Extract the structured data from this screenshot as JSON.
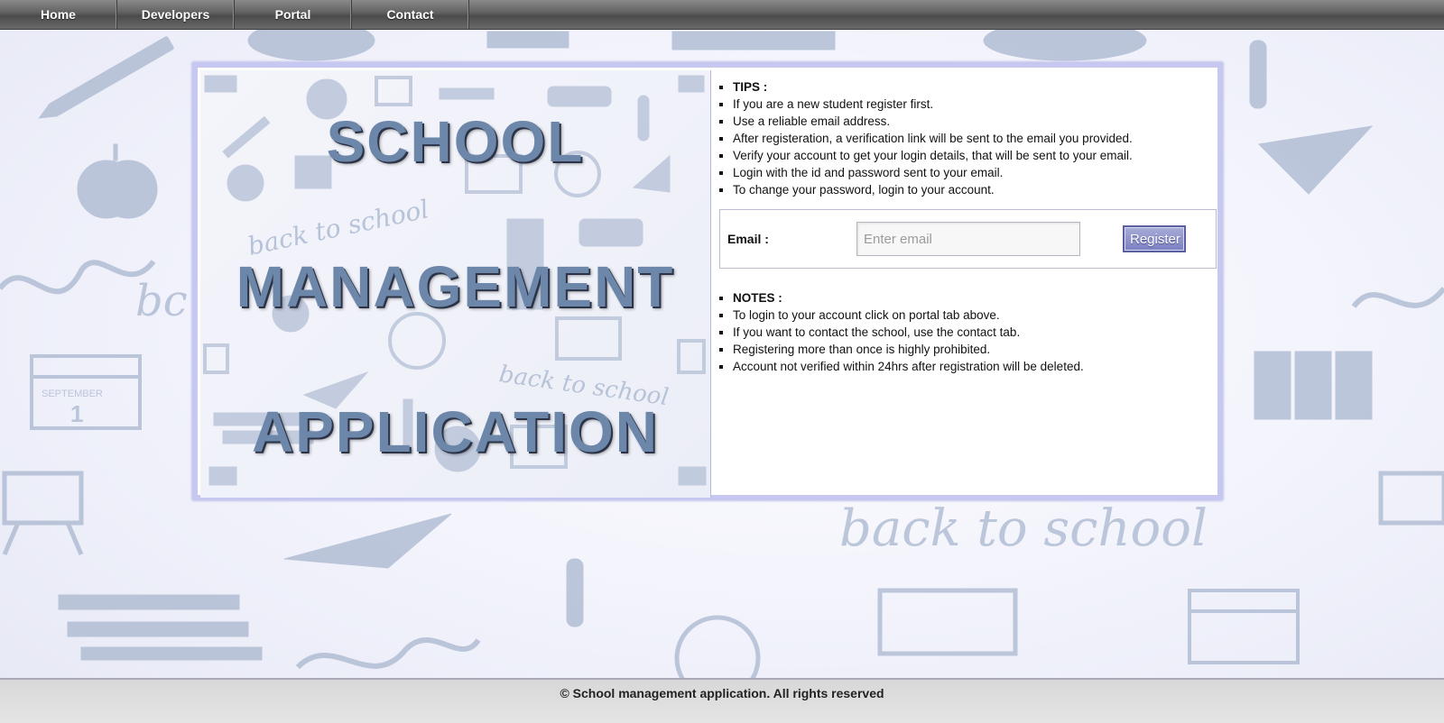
{
  "nav": {
    "items": [
      {
        "label": "Home"
      },
      {
        "label": "Developers"
      },
      {
        "label": "Portal"
      },
      {
        "label": "Contact"
      }
    ]
  },
  "hero": {
    "line1": "SCHOOL",
    "line2": "MANAGEMENT",
    "line3": "APPLICATION",
    "doodle_text": "back to school"
  },
  "tips": {
    "heading": "TIPS :",
    "items": [
      "If you are a new student register first.",
      "Use a reliable email address.",
      "After registeration, a verification link will be sent to the email you provided.",
      "Verify your account to get your login details, that will be sent to your email.",
      "Login with the id and password sent to your email.",
      "To change your password, login to your account."
    ]
  },
  "register": {
    "email_label": "Email :",
    "email_placeholder": "Enter email",
    "email_value": "",
    "button_label": "Register"
  },
  "notes": {
    "heading": "NOTES :",
    "items": [
      "To login to your account click on portal tab above.",
      "If you want to contact the school, use the contact tab.",
      "Registering more than once is highly prohibited.",
      "Account not verified within 24hrs after registration will be deleted."
    ]
  },
  "background": {
    "doodle_text": "back to school",
    "calendar_month": "SEPTEMBER",
    "calendar_day": "1"
  },
  "footer": {
    "text": "© School management application. All rights reserved"
  },
  "colors": {
    "doodle": "#a9b7cf",
    "panel_border": "#c6c8f2",
    "title": "#6c87aa",
    "button": "#7c80c2"
  }
}
